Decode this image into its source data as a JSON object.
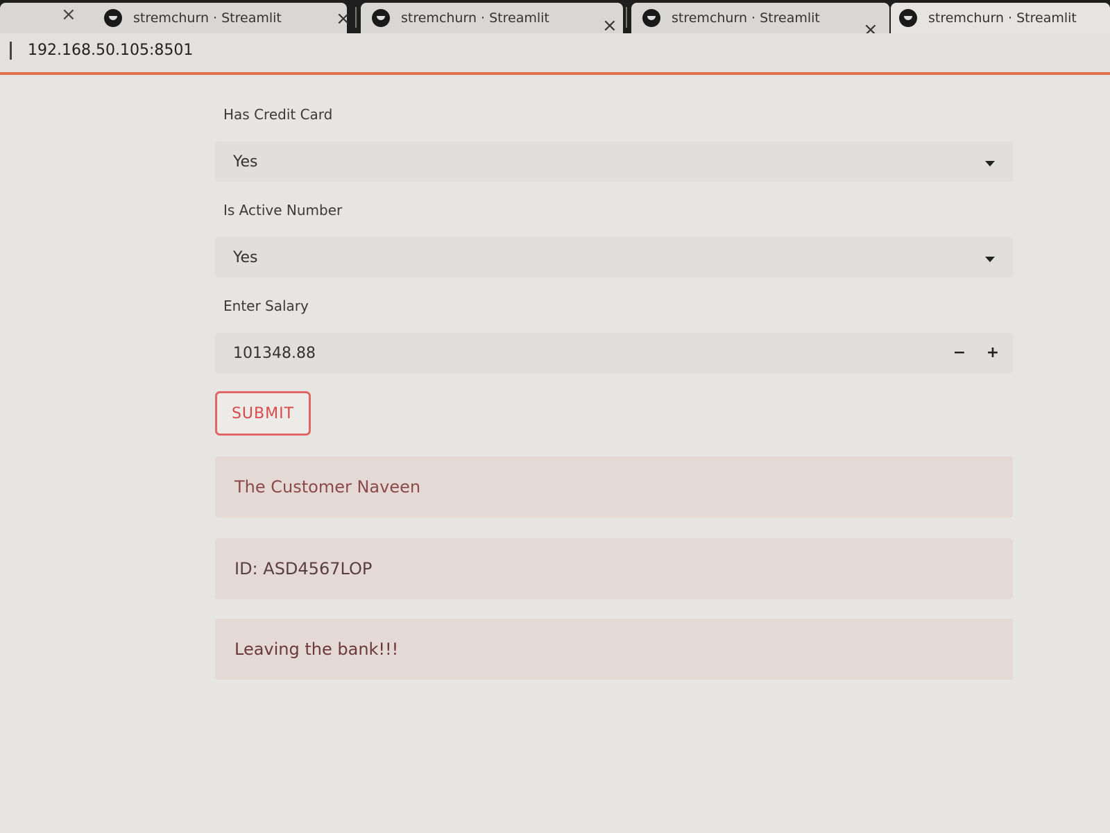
{
  "browser": {
    "tabs": [
      {
        "title": "stremchurn · Streamlit"
      },
      {
        "title": "stremchurn · Streamlit"
      },
      {
        "title": "stremchurn · Streamlit"
      },
      {
        "title": "stremchurn · Streamlit"
      }
    ],
    "close_glyph": "×",
    "address": "192.168.50.105:8501"
  },
  "form": {
    "credit_card": {
      "label": "Has Credit Card",
      "value": "Yes"
    },
    "active_number": {
      "label": "Is Active Number",
      "value": "Yes"
    },
    "salary": {
      "label": "Enter Salary",
      "value": "101348.88",
      "minus": "−",
      "plus": "+"
    },
    "submit_label": "SUBMIT"
  },
  "results": {
    "customer": "The Customer Naveen",
    "id": "ID: ASD4567LOP",
    "verdict": "Leaving the bank!!!"
  }
}
